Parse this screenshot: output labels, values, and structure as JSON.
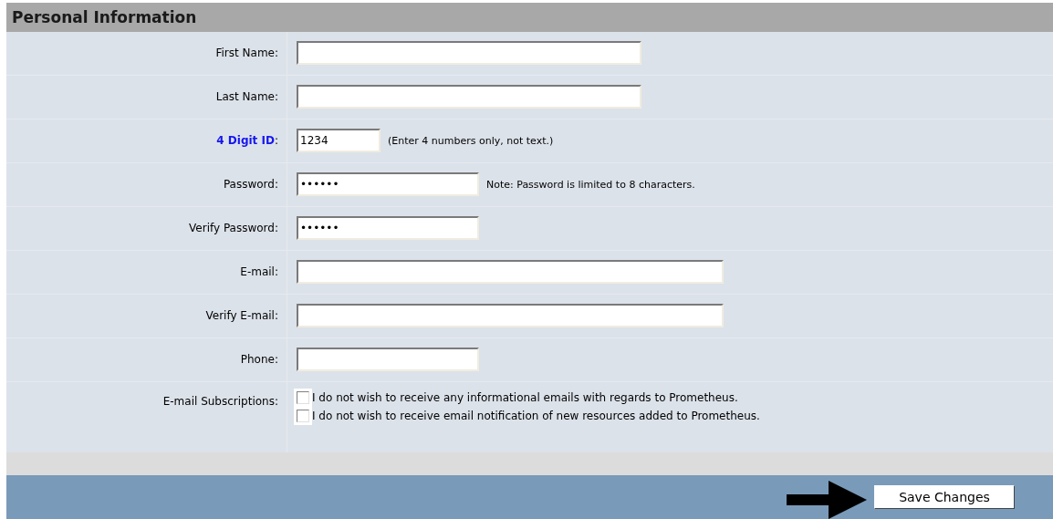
{
  "section": {
    "title": "Personal Information"
  },
  "fields": [
    {
      "label": "First Name:"
    },
    {
      "label": "Last Name:"
    },
    {
      "label": "**4 Digit ID**:",
      "value": "1234",
      "note": "(Enter 4 numbers only, not text.)"
    },
    {
      "label": "Password:",
      "value": "••••••",
      "note": "Note: Password is limited to 8 characters."
    },
    {
      "label": "Verify Password:",
      "value": "••••••"
    },
    {
      "label": "E-mail:"
    },
    {
      "label": "Verify E-mail:"
    },
    {
      "label": "Phone:"
    }
  ],
  "subscriptions": {
    "label": "E-mail Subscriptions:",
    "options": [
      {
        "text": "I do not wish to receive any informational emails with regards to Prometheus.",
        "checked": false
      },
      {
        "text": "I do not wish to receive email notification of new resources added to Prometheus.",
        "checked": false
      }
    ]
  },
  "save_button": "Save Changes"
}
